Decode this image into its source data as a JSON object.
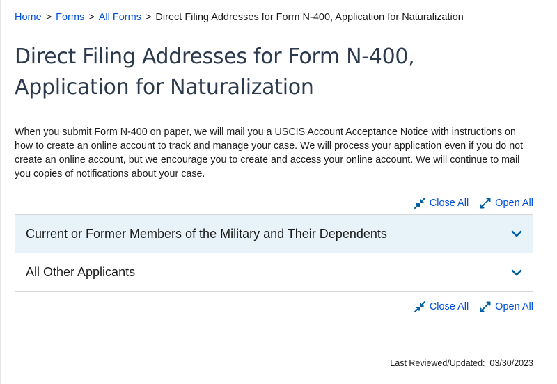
{
  "breadcrumb": {
    "items": [
      "Home",
      "Forms",
      "All Forms"
    ],
    "separator": ">",
    "current": "Direct Filing Addresses for Form N-400, Application for Naturalization"
  },
  "page": {
    "title": "Direct Filing Addresses for Form N-400, Application for Naturalization",
    "intro": "When you submit Form N-400 on paper, we will mail you a USCIS Account Acceptance Notice with instructions on how to create an online account to track and manage your case. We will process your application even if you do not create an online account, but we encourage you to create and access your online account. We will continue to mail you copies of notifications about your case."
  },
  "controls": {
    "close_all": "Close All",
    "open_all": "Open All"
  },
  "accordion": {
    "items": [
      {
        "title": "Current or Former Members of the Military and Their Dependents"
      },
      {
        "title": "All Other Applicants"
      }
    ]
  },
  "footer": {
    "last_reviewed": "Last Reviewed/Updated:  03/30/2023"
  },
  "colors": {
    "link": "#0050d8",
    "heading": "#2c3a4d",
    "accordion_active_bg": "#e7f2f9",
    "icon": "#005ea2"
  }
}
